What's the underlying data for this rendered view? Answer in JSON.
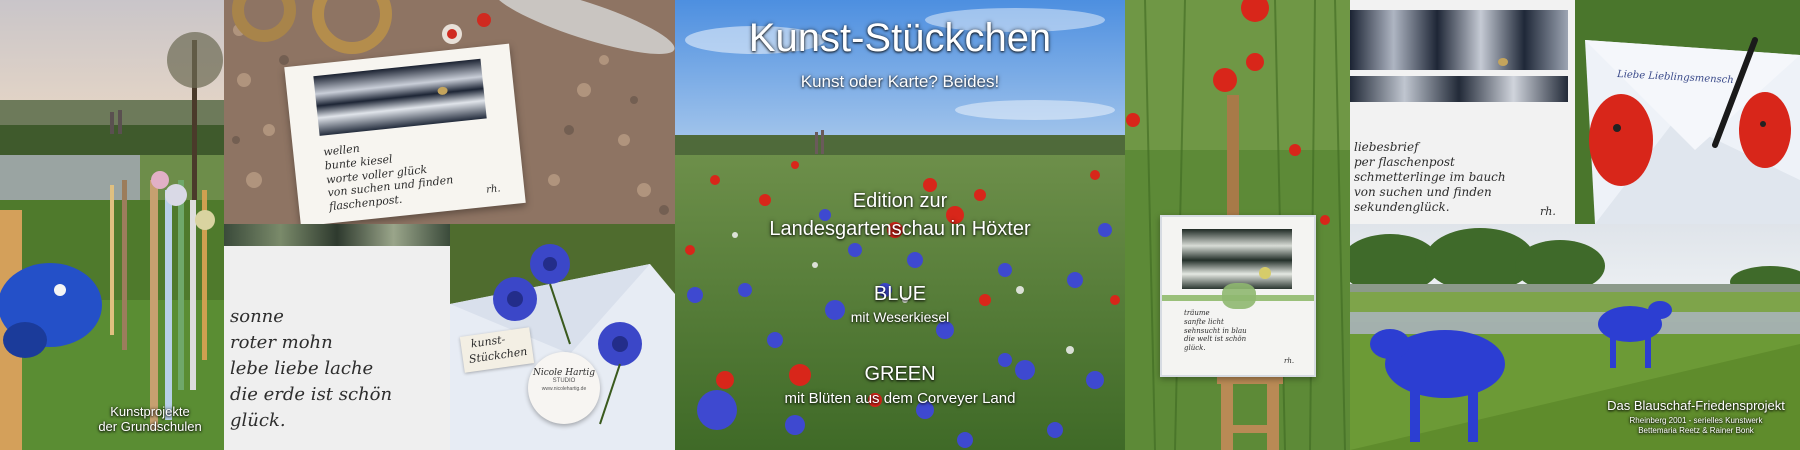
{
  "banner": {
    "title": "Kunst-Stückchen",
    "subtitle": "Kunst oder Karte? Beides!",
    "edition_line1": "Edition zur",
    "edition_line2": "Landesgartenschau in Höxter",
    "blue_label": "BLUE",
    "blue_desc": "mit Weserkiesel",
    "green_label": "GREEN",
    "green_desc": "mit Blüten aus dem Corveyer Land"
  },
  "captions": {
    "schools_line1": "Kunstprojekte",
    "schools_line2": "der Grundschulen",
    "blauschaf_title": "Das Blauschaf-Friedensprojekt",
    "blauschaf_line1": "Rheinberg  2001 - serielles Kunstwerk",
    "blauschaf_line2": "Bettemaria Reetz & Rainer Bonk"
  },
  "handwritten": {
    "stones_card": "wellen\nbunte kiesel\nworte voller glück\nvon suchen und finden\nflaschenpost.",
    "stones_sign": "rh.",
    "mohn_card": "sonne\nroter mohn\nlebe liebe lache\ndie erde ist schön\nglück.",
    "envelope_label1": "kunst-",
    "envelope_label2": "Stückchen",
    "tag_line1": "Nicole Hartig",
    "tag_line2": "STUDIO",
    "tag_line3": "www.nicolehartig.de",
    "easel_card": "träume\nsanfte licht\nsehnsucht in blau\ndie welt ist schön\nglück.",
    "easel_sign": "rh.",
    "letter_card": "liebesbrief\nper flaschenpost\nschmetterlinge im bauch\nvon suchen und finden\nsekundenglück.",
    "letter_sign": "rh.",
    "envelope_note": "Liebe Lieblingsmensch"
  },
  "colors": {
    "sky": "#6fa3dd",
    "poppy": "#d8261a",
    "cornflower": "#3e49d0",
    "grass": "#5f8a3b",
    "sheep": "#2c3ed2"
  }
}
